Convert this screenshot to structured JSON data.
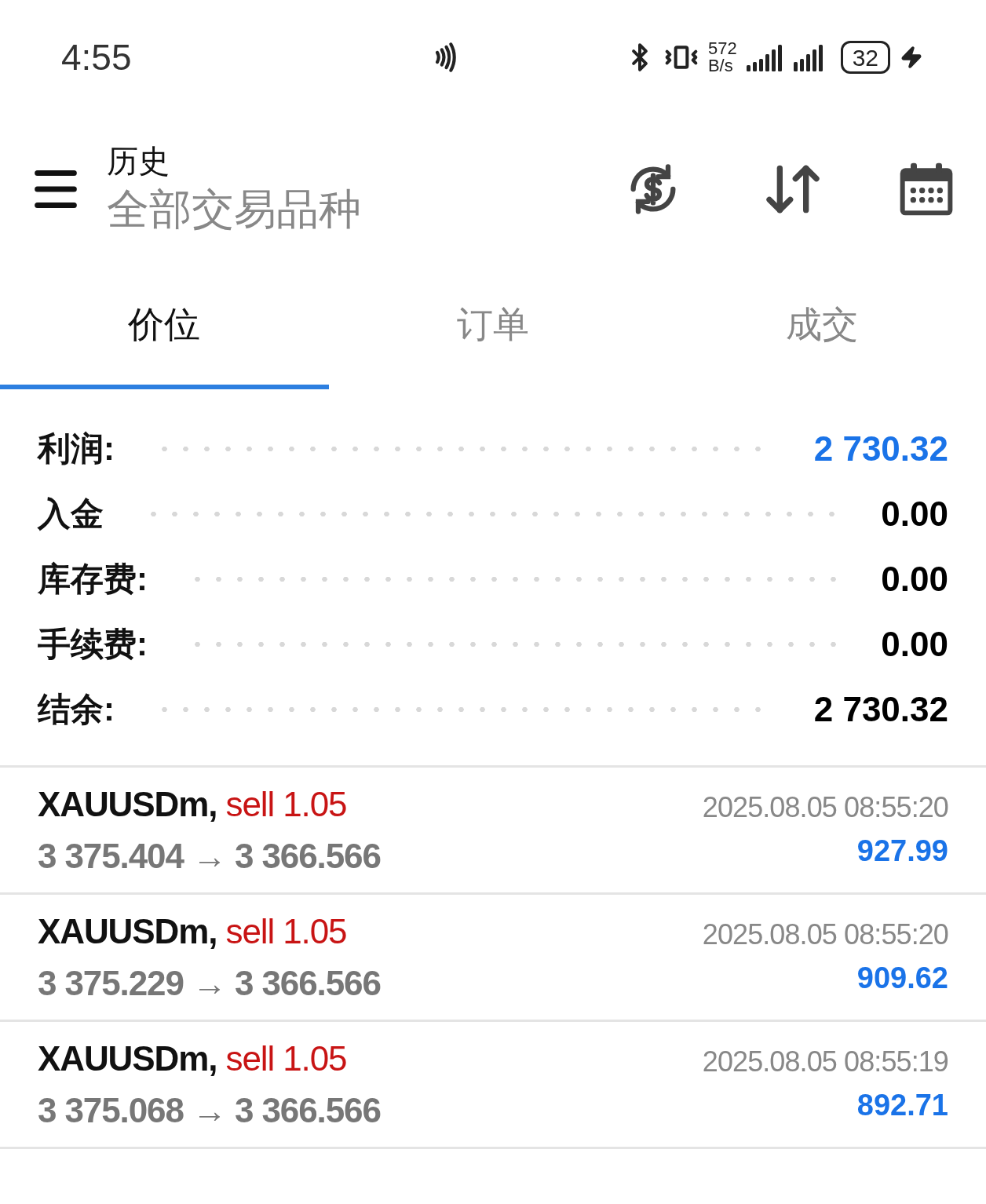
{
  "status_bar": {
    "time": "4:55",
    "network_speed": "572",
    "network_unit": "B/s",
    "battery": "32",
    "charging": true
  },
  "header": {
    "title": "历史",
    "subtitle": "全部交易品种"
  },
  "tabs": [
    {
      "label": "价位",
      "selected": true
    },
    {
      "label": "订单",
      "selected": false
    },
    {
      "label": "成交",
      "selected": false
    }
  ],
  "summary": [
    {
      "label": "利润:",
      "value": "2 730.32",
      "color": "#1a73e8"
    },
    {
      "label": "入金",
      "value": "0.00",
      "color": "#000000"
    },
    {
      "label": "库存费:",
      "value": "0.00",
      "color": "#000000"
    },
    {
      "label": "手续费:",
      "value": "0.00",
      "color": "#000000"
    },
    {
      "label": "结余:",
      "value": "2 730.32",
      "color": "#000000"
    }
  ],
  "trades": [
    {
      "symbol": "XAUUSDm,",
      "side": "sell 1.05",
      "prices": "3 375.404 → 3 366.566",
      "time": "2025.08.05 08:55:20",
      "profit": "927.99"
    },
    {
      "symbol": "XAUUSDm,",
      "side": "sell 1.05",
      "prices": "3 375.229 → 3 366.566",
      "time": "2025.08.05 08:55:20",
      "profit": "909.62"
    },
    {
      "symbol": "XAUUSDm,",
      "side": "sell 1.05",
      "prices": "3 375.068 → 3 366.566",
      "time": "2025.08.05 08:55:19",
      "profit": "892.71"
    }
  ]
}
